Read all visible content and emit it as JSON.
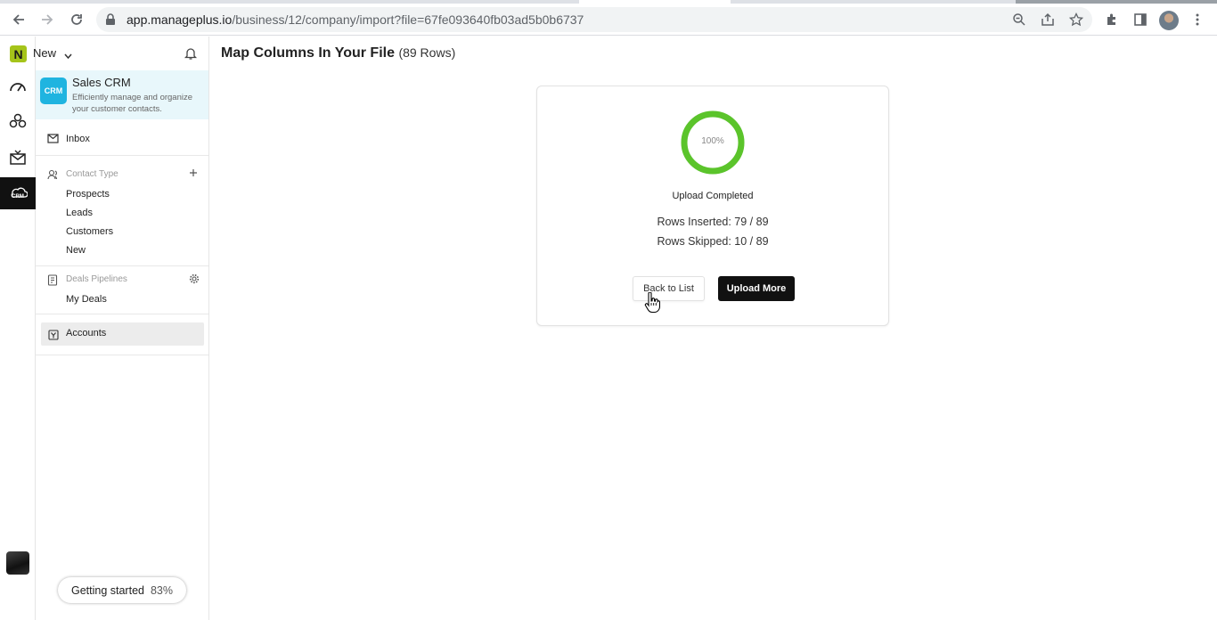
{
  "browser": {
    "url_domain": "app.manageplus.io",
    "url_path": "/business/12/company/import?file=67fe093640fb03ad5b0b6737",
    "icons": [
      "back-icon",
      "forward-icon",
      "reload-icon",
      "lock-icon",
      "zoom-icon",
      "share-icon",
      "star-icon",
      "extensions-icon",
      "sidepanel-icon",
      "profile-avatar",
      "menu-icon"
    ]
  },
  "rail": {
    "logo_letter": "N",
    "items": [
      "dashboard-icon",
      "apps-icon",
      "mail-icon",
      "crm-icon"
    ],
    "active": "crm-icon",
    "crm_text": "CRM"
  },
  "sidebar": {
    "workspace": "New",
    "app": {
      "logo_text": "CRM",
      "title": "Sales CRM",
      "description": "Efficiently manage and organize your customer contacts."
    },
    "inbox": "Inbox",
    "contact_type": {
      "header": "Contact Type",
      "items": [
        "Prospects",
        "Leads",
        "Customers",
        "New"
      ]
    },
    "deals": {
      "header": "Deals Pipelines",
      "items": [
        "My Deals"
      ]
    },
    "accounts": "Accounts",
    "getting_started": {
      "label": "Getting started",
      "percent": "83%"
    }
  },
  "main": {
    "title": "Map Columns In Your File",
    "rows_count": "(89 Rows)",
    "progress": {
      "value": 100,
      "label": "100%",
      "color": "#5bc42b"
    },
    "status": "Upload Completed",
    "rows_inserted": "Rows Inserted: 79 / 89",
    "rows_skipped": "Rows Skipped: 10 / 89",
    "back_button": "Back to List",
    "upload_button": "Upload More"
  }
}
